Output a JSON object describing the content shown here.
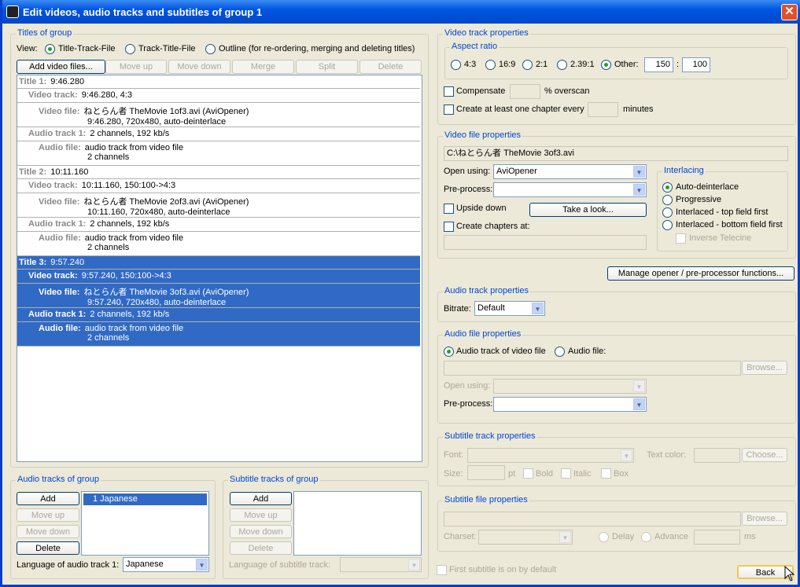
{
  "window": {
    "title": "Edit videos, audio tracks and subtitles of group 1"
  },
  "titles_group": {
    "legend": "Titles of group",
    "view_label": "View:",
    "view_options": [
      "Title-Track-File",
      "Track-Title-File",
      "Outline (for re-ordering, merging and deleting titles)"
    ],
    "buttons": {
      "add": "Add video files...",
      "up": "Move up",
      "down": "Move down",
      "merge": "Merge",
      "split": "Split",
      "delete": "Delete"
    },
    "tree": [
      {
        "kind": "title",
        "h": "Title 1:",
        "v": "9:46.280"
      },
      {
        "kind": "vt",
        "h": "Video track:",
        "v": "9:46.280, 4:3"
      },
      {
        "kind": "vf",
        "h": "Video file:",
        "v": "ねとらん者 TheMovie 1of3.avi (AviOpener)",
        "v2": "9:46.280, 720x480, auto-deinterlace"
      },
      {
        "kind": "at",
        "h": "Audio track 1:",
        "v": "2 channels, 192 kb/s"
      },
      {
        "kind": "af",
        "h": "Audio file:",
        "v": "audio track from video file",
        "v2": "2 channels"
      },
      {
        "kind": "title",
        "h": "Title 2:",
        "v": "10:11.160"
      },
      {
        "kind": "vt",
        "h": "Video track:",
        "v": "10:11.160, 150:100->4:3"
      },
      {
        "kind": "vf",
        "h": "Video file:",
        "v": "ねとらん者 TheMovie 2of3.avi (AviOpener)",
        "v2": "10:11.160, 720x480, auto-deinterlace"
      },
      {
        "kind": "at",
        "h": "Audio track 1:",
        "v": "2 channels, 192 kb/s"
      },
      {
        "kind": "af",
        "h": "Audio file:",
        "v": "audio track from video file",
        "v2": "2 channels"
      },
      {
        "kind": "title",
        "h": "Title 3:",
        "v": "9:57.240"
      },
      {
        "kind": "vt",
        "h": "Video track:",
        "v": "9:57.240, 150:100->4:3"
      },
      {
        "kind": "vf",
        "h": "Video file:",
        "v": "ねとらん者 TheMovie 3of3.avi (AviOpener)",
        "v2": "9:57.240, 720x480, auto-deinterlace"
      },
      {
        "kind": "at",
        "h": "Audio track 1:",
        "v": "2 channels, 192 kb/s"
      },
      {
        "kind": "af",
        "h": "Audio file:",
        "v": "audio track from video file",
        "v2": "2 channels"
      }
    ]
  },
  "audio_tracks": {
    "legend": "Audio tracks of group",
    "add": "Add",
    "up": "Move up",
    "down": "Move down",
    "delete": "Delete",
    "items": [
      "1   Japanese"
    ],
    "lang_label": "Language of audio track 1:",
    "lang_value": "Japanese"
  },
  "subtitle_tracks": {
    "legend": "Subtitle tracks of group",
    "add": "Add",
    "up": "Move up",
    "down": "Move down",
    "delete": "Delete",
    "lang_label": "Language of subtitle track:"
  },
  "video_track": {
    "legend": "Video track properties",
    "aspect_legend": "Aspect ratio",
    "aspect_options": [
      "4:3",
      "16:9",
      "2:1",
      "2.39:1",
      "Other:"
    ],
    "other_w": "150",
    "other_sep": ":",
    "other_h": "100",
    "compensate": "Compensate",
    "overscan": "% overscan",
    "chapter_every": "Create at least one chapter every",
    "minutes": "minutes"
  },
  "video_file": {
    "legend": "Video file properties",
    "path": "C:\\ねとらん者 TheMovie 3of3.avi",
    "open_label": "Open using:",
    "open_value": "AviOpener",
    "pre_label": "Pre-process:",
    "upside": "Upside down",
    "look": "Take a look...",
    "chapters_at": "Create chapters at:",
    "interlacing_legend": "Interlacing",
    "interlacing": [
      "Auto-deinterlace",
      "Progressive",
      "Interlaced - top field first",
      "Interlaced - bottom field first"
    ],
    "inverse": "Inverse Telecine"
  },
  "manage_btn": "Manage opener / pre-processor functions...",
  "audio_track": {
    "legend": "Audio track properties",
    "bitrate_label": "Bitrate:",
    "bitrate_value": "Default"
  },
  "audio_file": {
    "legend": "Audio file properties",
    "opt_video": "Audio track of video file",
    "opt_file": "Audio file:",
    "browse": "Browse...",
    "open_label": "Open using:",
    "pre_label": "Pre-process:"
  },
  "subtitle_track": {
    "legend": "Subtitle track properties",
    "font": "Font:",
    "text_color": "Text color:",
    "choose": "Choose...",
    "size": "Size:",
    "pt": "pt",
    "bold": "Bold",
    "italic": "Italic",
    "box": "Box"
  },
  "subtitle_file": {
    "legend": "Subtitle file properties",
    "browse": "Browse...",
    "charset": "Charset:",
    "delay": "Delay",
    "advance": "Advance",
    "ms": "ms"
  },
  "first_sub": "First subtitle is on by default",
  "back": "Back"
}
